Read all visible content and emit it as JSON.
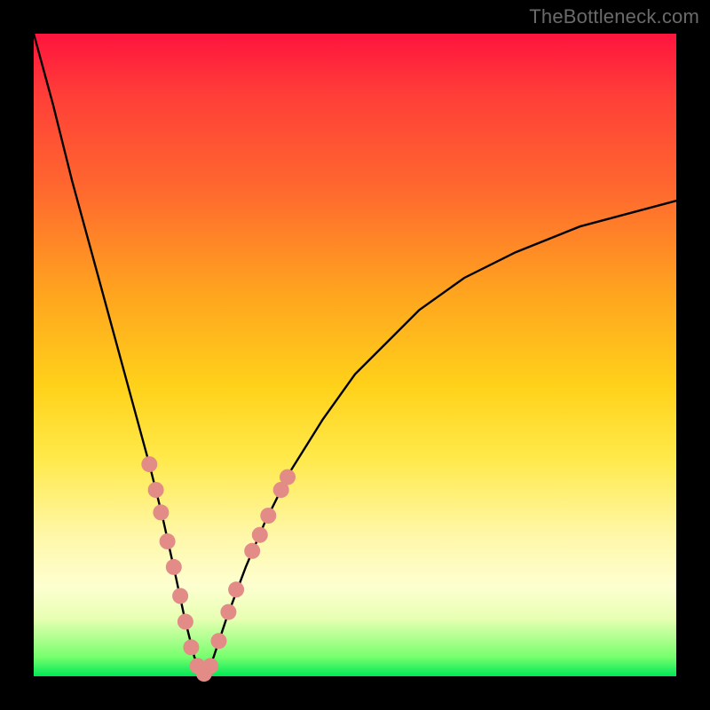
{
  "watermark": "TheBottleneck.com",
  "chart_data": {
    "type": "line",
    "title": "",
    "xlabel": "",
    "ylabel": "",
    "xlim": [
      0,
      100
    ],
    "ylim": [
      0,
      100
    ],
    "grid": false,
    "legend": false,
    "comment": "V-shaped bottleneck curve on rainbow gradient. Axes have no visible tick labels; x/y values are normalized 0–100. Curve reaches y=0 near x≈26. Left branch rises to y≈100 at x≈0; right branch rises asymptotically toward y≈74 at x=100. Salmon-colored marker clusters sit on both branches near the trough.",
    "series": [
      {
        "name": "bottleneck-curve",
        "color": "#000000",
        "x": [
          0,
          3,
          6,
          9,
          12,
          15,
          18,
          20,
          22,
          23.5,
          25,
          26.5,
          28,
          30,
          33,
          36,
          40,
          45,
          50,
          55,
          60,
          67,
          75,
          85,
          100
        ],
        "y": [
          100,
          89,
          77,
          66,
          55,
          44,
          33,
          25,
          16,
          9,
          3,
          0,
          3,
          9,
          17,
          24,
          32,
          40,
          47,
          52,
          57,
          62,
          66,
          70,
          74
        ]
      }
    ],
    "markers": {
      "name": "highlight-dots",
      "color": "#e28b87",
      "radius_px": 9,
      "points": [
        {
          "x": 18.0,
          "y": 33.0
        },
        {
          "x": 19.0,
          "y": 29.0
        },
        {
          "x": 19.8,
          "y": 25.5
        },
        {
          "x": 20.8,
          "y": 21.0
        },
        {
          "x": 21.8,
          "y": 17.0
        },
        {
          "x": 22.8,
          "y": 12.5
        },
        {
          "x": 23.6,
          "y": 8.5
        },
        {
          "x": 24.5,
          "y": 4.5
        },
        {
          "x": 25.5,
          "y": 1.6
        },
        {
          "x": 26.5,
          "y": 0.4
        },
        {
          "x": 27.5,
          "y": 1.6
        },
        {
          "x": 28.8,
          "y": 5.5
        },
        {
          "x": 30.3,
          "y": 10.0
        },
        {
          "x": 31.5,
          "y": 13.5
        },
        {
          "x": 34.0,
          "y": 19.5
        },
        {
          "x": 35.2,
          "y": 22.0
        },
        {
          "x": 36.5,
          "y": 25.0
        },
        {
          "x": 38.5,
          "y": 29.0
        },
        {
          "x": 39.5,
          "y": 31.0
        }
      ]
    }
  }
}
